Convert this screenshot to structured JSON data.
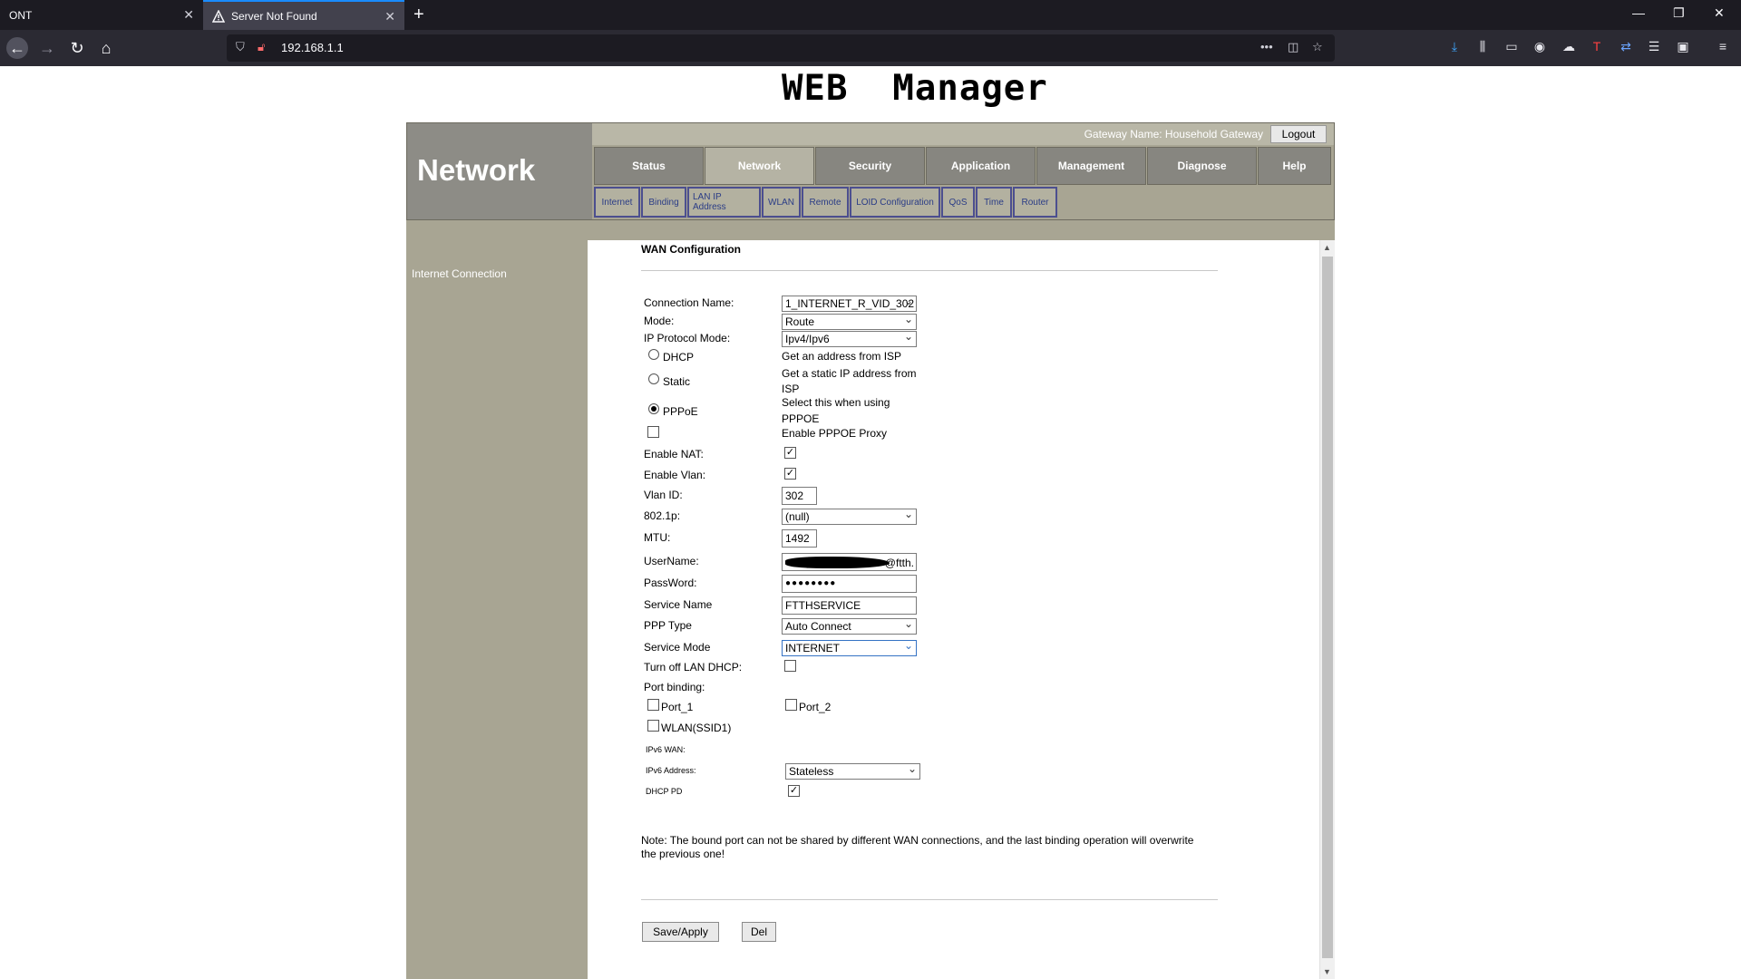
{
  "browser": {
    "tabs": [
      {
        "title": "ONT"
      },
      {
        "title": "Server Not Found"
      }
    ],
    "url": "192.168.1.1"
  },
  "page": {
    "title": "WEB  Manager",
    "brand": "Network",
    "gateway_name": "Gateway Name: Household Gateway",
    "logout_label": "Logout",
    "main_tabs": [
      "Status",
      "Network",
      "Security",
      "Application",
      "Management",
      "Diagnose",
      "Help"
    ],
    "active_main_tab": "Network",
    "sub_tabs": [
      "Internet",
      "Binding",
      "LAN IP Address",
      "WLAN",
      "Remote",
      "LOID Configuration",
      "QoS",
      "Time",
      "Router"
    ],
    "sidebar_item": "Internet Connection"
  },
  "form": {
    "section_title": "WAN Configuration",
    "connection_name_label": "Connection Name:",
    "connection_name_value": "1_INTERNET_R_VID_302",
    "mode_label": "Mode:",
    "mode_value": "Route",
    "ip_protocol_label": "IP Protocol Mode:",
    "ip_protocol_value": "Ipv4/Ipv6",
    "dhcp_label": "DHCP",
    "dhcp_desc": "Get an address from ISP",
    "static_label": "Static",
    "static_desc_1": "Get a static IP address from",
    "static_desc_2": "ISP",
    "pppoe_label": "PPPoE",
    "pppoe_desc_1": "Select this when using",
    "pppoe_desc_2": "PPPOE",
    "selected_mode": "PPPoE",
    "pppoe_proxy_label": "Enable PPPOE Proxy",
    "pppoe_proxy_checked": false,
    "enable_nat_label": "Enable NAT:",
    "enable_nat_checked": true,
    "enable_vlan_label": "Enable Vlan:",
    "enable_vlan_checked": true,
    "vlan_id_label": "Vlan ID:",
    "vlan_id_value": "302",
    "p8021_label": "802.1p:",
    "p8021_value": "(null)",
    "mtu_label": "MTU:",
    "mtu_value": "1492",
    "username_label": "UserName:",
    "username_visible_suffix": "@ftth.",
    "password_label": "PassWord:",
    "password_value": "●●●●●●●●",
    "service_name_label": "Service Name",
    "service_name_value": "FTTHSERVICE",
    "ppp_type_label": "PPP Type",
    "ppp_type_value": "Auto Connect",
    "service_mode_label": "Service Mode",
    "service_mode_value": "INTERNET",
    "turn_off_dhcp_label": "Turn off LAN DHCP:",
    "turn_off_dhcp_checked": false,
    "port_binding_label": "Port binding:",
    "port1_label": "Port_1",
    "port2_label": "Port_2",
    "wlan_label": "WLAN(SSID1)",
    "ipv6_wan_label": "IPv6 WAN:",
    "ipv6_address_label": "IPv6 Address:",
    "ipv6_address_value": "Stateless",
    "dhcp_pd_label": "DHCP PD",
    "dhcp_pd_checked": true,
    "note_1": "Note: The bound port can not be shared by different WAN connections, and the last binding operation will overwrite",
    "note_2": "the previous one!",
    "save_label": "Save/Apply",
    "del_label": "Del"
  },
  "colors": {
    "frame": "#a8a593",
    "brand_bg": "#8d8c86",
    "tab_bg": "#878680",
    "subtab_border": "#4c4f8f"
  }
}
